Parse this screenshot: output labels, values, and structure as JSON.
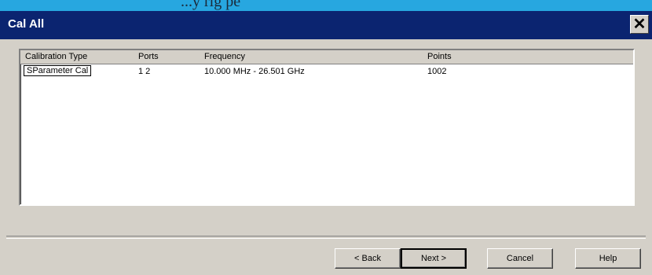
{
  "banner": {
    "text": "...y     rig    pe"
  },
  "window": {
    "title": "Cal All",
    "close_glyph": "✕"
  },
  "list": {
    "columns": [
      "Calibration Type",
      "Ports",
      "Frequency",
      "Points"
    ],
    "rows": [
      {
        "type": "SParameter Cal",
        "ports": "1 2",
        "frequency": "10.000 MHz - 26.501 GHz",
        "points": "1002"
      }
    ]
  },
  "buttons": {
    "back": "< Back",
    "next": "Next >",
    "cancel": "Cancel",
    "help": "Help"
  }
}
